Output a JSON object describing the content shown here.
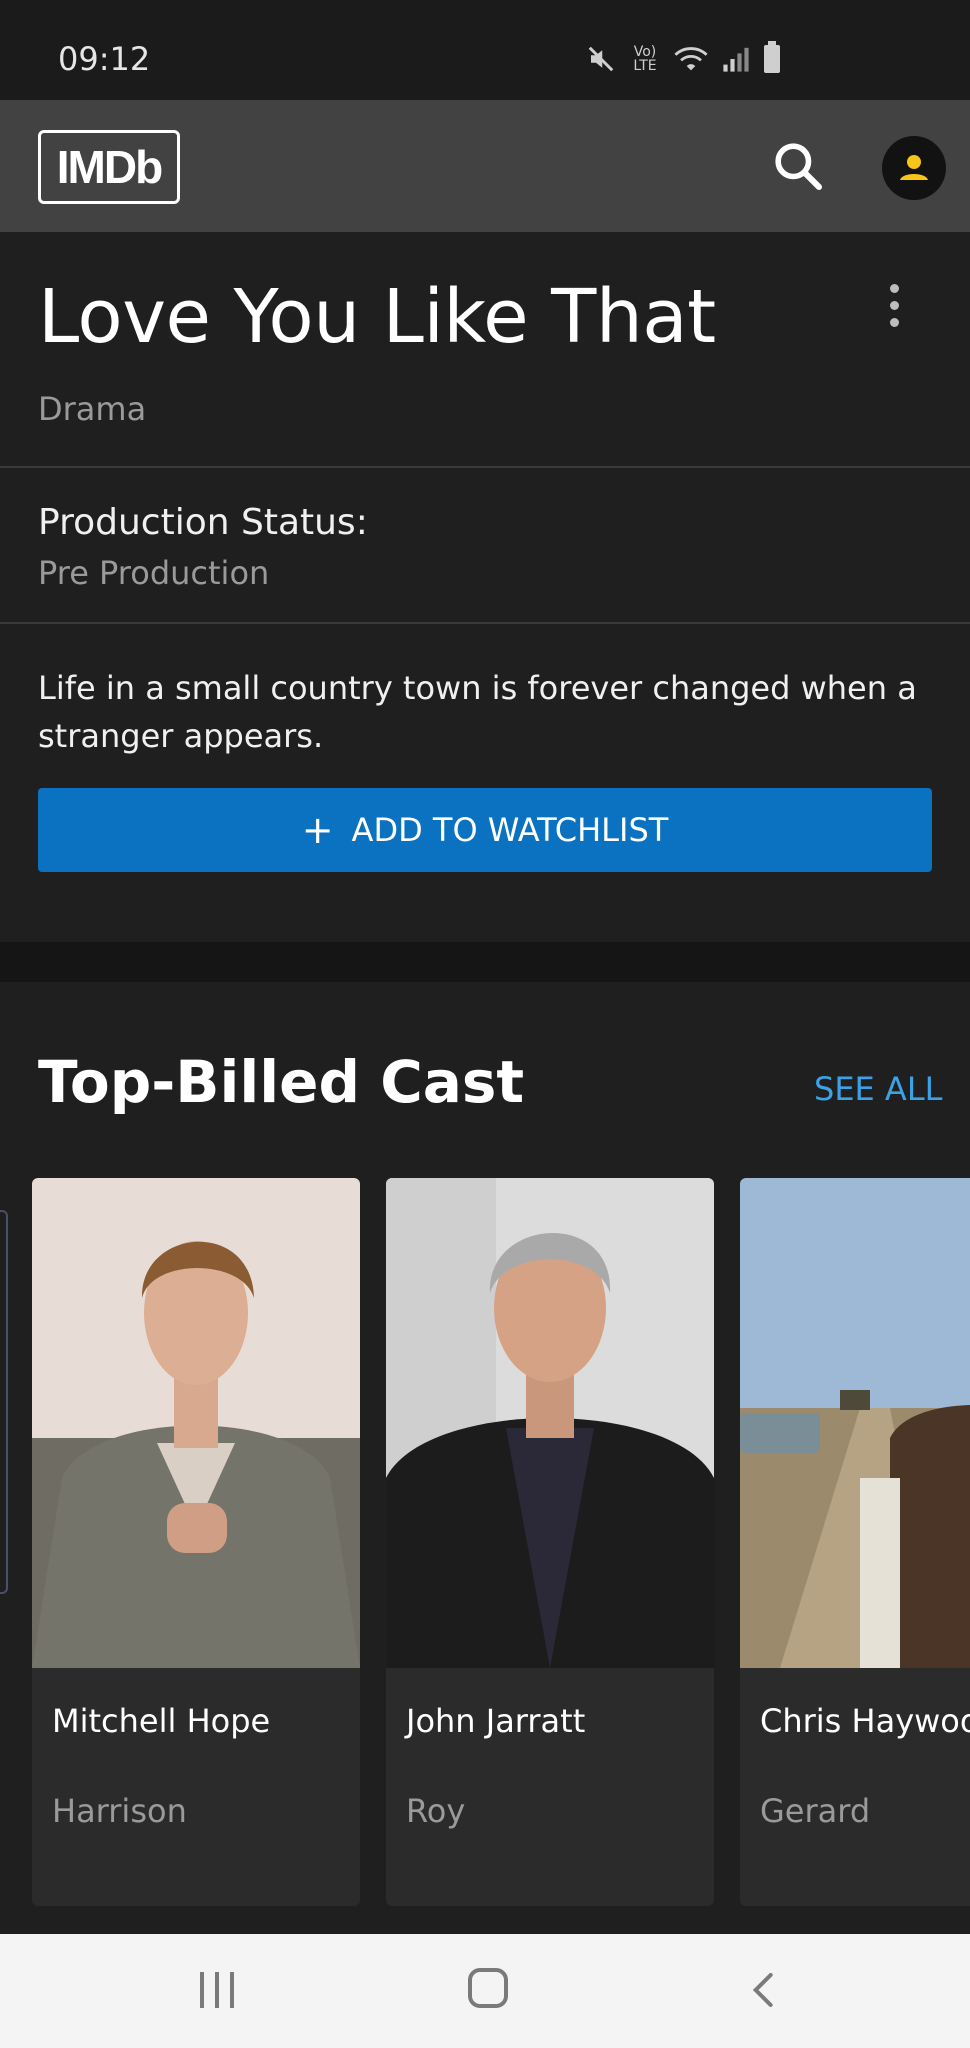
{
  "status_bar": {
    "time": "09:12",
    "icons": [
      "mute-icon",
      "volte-icon",
      "wifi-icon",
      "signal-icon",
      "battery-icon"
    ],
    "volte_label": "Vo) LTE"
  },
  "header": {
    "logo": "IMDb",
    "icons": [
      "search-icon",
      "account-icon"
    ],
    "accent_color": "#f5c518"
  },
  "title_section": {
    "title": "Love You Like That",
    "genre": "Drama"
  },
  "production": {
    "label": "Production Status:",
    "value": "Pre Production"
  },
  "plot": "Life in a small country town is forever changed when a stranger appears.",
  "watchlist_button": {
    "icon": "+",
    "label": "ADD TO WATCHLIST",
    "color": "#0a72c0"
  },
  "cast": {
    "heading": "Top-Billed Cast",
    "see_all": "SEE ALL",
    "see_all_color": "#3aa3e8",
    "members": [
      {
        "name": "Mitchell Hope",
        "role": "Harrison"
      },
      {
        "name": "John Jarratt",
        "role": "Roy"
      },
      {
        "name": "Chris Haywood",
        "role": "Gerard"
      }
    ]
  },
  "nav_bar": {
    "icons": [
      "recent-apps-icon",
      "home-icon",
      "back-icon"
    ]
  }
}
